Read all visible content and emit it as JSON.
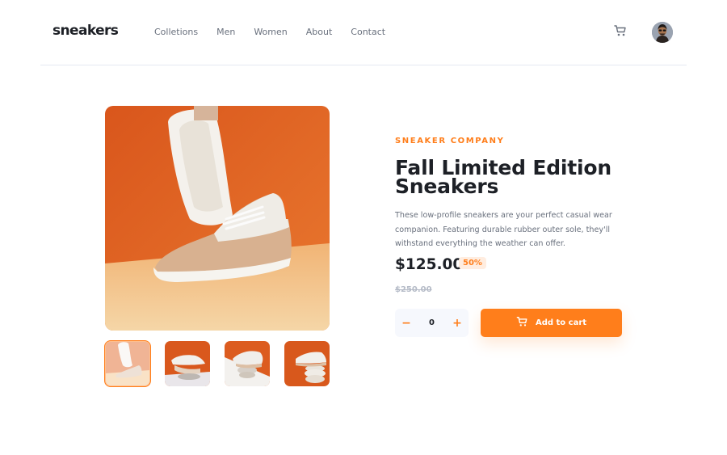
{
  "header": {
    "logo": "sneakers",
    "nav": [
      "Colletions",
      "Men",
      "Women",
      "About",
      "Contact"
    ],
    "icons": {
      "cart": "cart-icon",
      "avatar": "avatar"
    }
  },
  "gallery": {
    "thumbnails": [
      "product-1",
      "product-2",
      "product-3",
      "product-4"
    ],
    "active_index": 0
  },
  "product": {
    "company": "SNEAKER COMPANY",
    "title": "Fall Limited Edition Sneakers",
    "description": "These low-profile sneakers are your perfect casual wear companion. Featuring durable rubber outer sole, they'll withstand everything the weather can offer.",
    "price": "$125.00",
    "discount": "50%",
    "old_price": "$250.00"
  },
  "cart_controls": {
    "minus": "−",
    "quantity": "0",
    "plus": "+",
    "add_label": "Add to cart"
  },
  "colors": {
    "accent": "#ff7e1b",
    "accent_pale": "#ffede0",
    "text_dark": "#1d2026",
    "text_muted": "#69707d"
  }
}
